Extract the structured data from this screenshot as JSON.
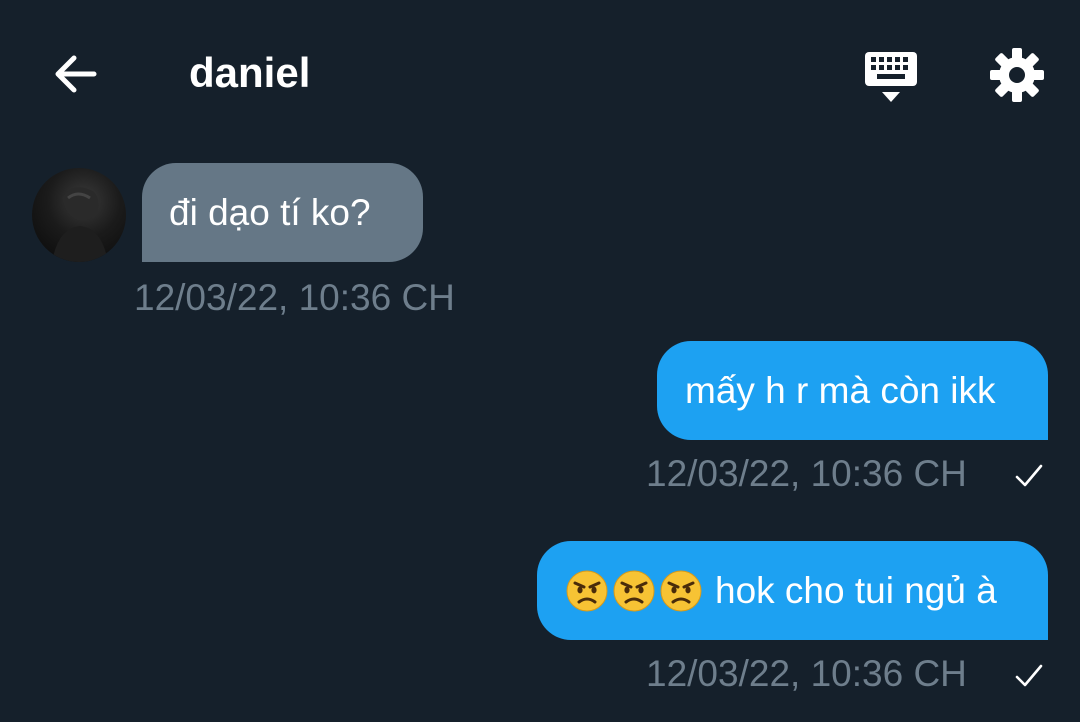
{
  "header": {
    "title": "daniel",
    "back_icon": "arrow-left-icon",
    "keyboard_icon": "keyboard-hide-icon",
    "settings_icon": "gear-icon"
  },
  "colors": {
    "background": "#15202b",
    "incoming_bubble": "#657786",
    "outgoing_bubble": "#1da1f2",
    "timestamp": "#6e7e8c",
    "text": "#ffffff"
  },
  "messages": [
    {
      "direction": "incoming",
      "text": "đi dạo tí ko?",
      "timestamp": "12/03/22, 10:36 CH",
      "avatar": "avatar-photo"
    },
    {
      "direction": "outgoing",
      "text": "mấy h r mà còn ikk",
      "timestamp": "12/03/22, 10:36 CH",
      "status_icon": "check-icon"
    },
    {
      "direction": "outgoing",
      "emojis": [
        "angry-face-icon",
        "angry-face-icon",
        "angry-face-icon"
      ],
      "text": "hok cho tui ngủ à",
      "timestamp": "12/03/22, 10:36 CH",
      "status_icon": "check-icon"
    }
  ]
}
